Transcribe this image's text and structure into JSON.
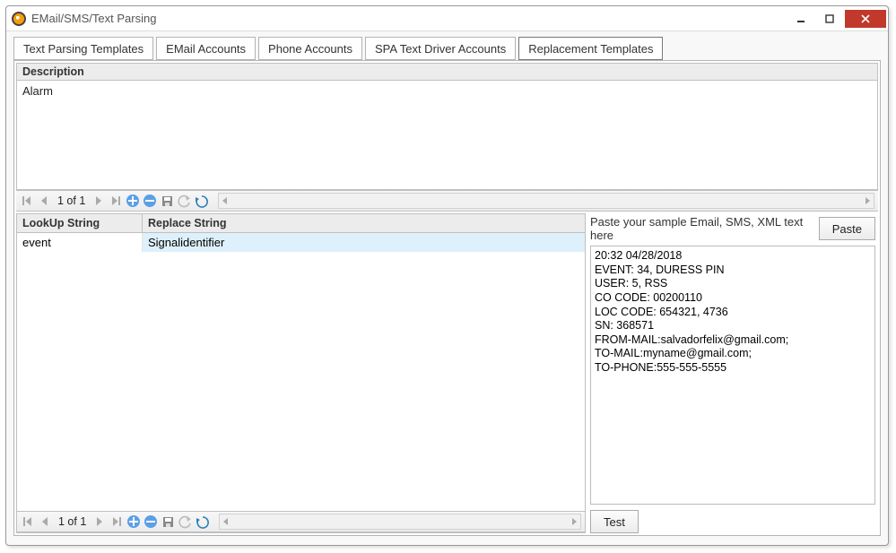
{
  "window": {
    "title": "EMail/SMS/Text Parsing"
  },
  "tabs": [
    {
      "label": "Text Parsing Templates",
      "active": false
    },
    {
      "label": "EMail Accounts",
      "active": false
    },
    {
      "label": "Phone Accounts",
      "active": false
    },
    {
      "label": "SPA Text Driver Accounts",
      "active": false
    },
    {
      "label": "Replacement Templates",
      "active": true
    }
  ],
  "top_grid": {
    "column": "Description",
    "rows": [
      "Alarm"
    ],
    "nav": "1 of 1"
  },
  "bottom_grid": {
    "columns": [
      "LookUp String",
      "Replace String"
    ],
    "rows": [
      {
        "lookup": "event",
        "replace": "Signalidentifier"
      }
    ],
    "nav": "1 of 1"
  },
  "right": {
    "hint": "Paste your sample Email, SMS, XML text here",
    "paste_label": "Paste",
    "sample": "20:32 04/28/2018\nEVENT: 34, DURESS PIN\nUSER: 5, RSS\nCO CODE: 00200110\nLOC CODE: 654321, 4736\nSN: 368571\nFROM-MAIL:salvadorfelix@gmail.com;\nTO-MAIL:myname@gmail.com;\nTO-PHONE:555-555-5555",
    "test_label": "Test"
  }
}
